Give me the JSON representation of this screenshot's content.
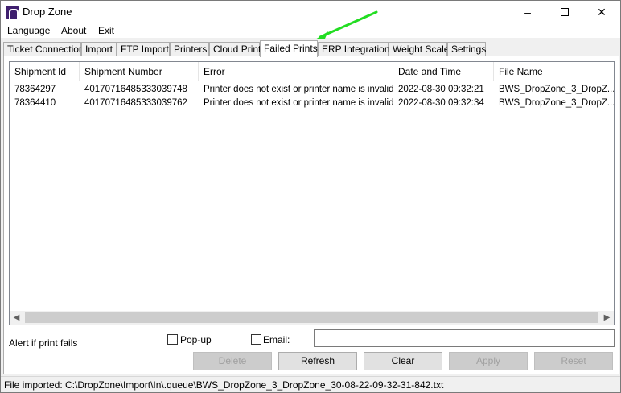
{
  "window": {
    "title": "Drop Zone",
    "icon": "app-logo-icon"
  },
  "controls": {
    "minimize": "–",
    "maximize": "",
    "close": "✕"
  },
  "menu": [
    "Language",
    "About",
    "Exit"
  ],
  "tabs": [
    "Ticket Connection",
    "Import",
    "FTP Import",
    "Printers",
    "Cloud Print",
    "Failed Prints",
    "ERP Integration",
    "Weight Scale",
    "Settings"
  ],
  "active_tab": "Failed Prints",
  "table": {
    "columns": [
      "Shipment Id",
      "Shipment Number",
      "Error",
      "Date and Time",
      "File Name"
    ],
    "rows": [
      [
        "78364297",
        "40170716485333039748",
        "Printer does not exist or printer name is invalid.",
        "2022-08-30 09:32:21",
        "BWS_DropZone_3_DropZ..."
      ],
      [
        "78364410",
        "40170716485333039762",
        "Printer does not exist or printer name is invalid.",
        "2022-08-30 09:32:34",
        "BWS_DropZone_3_DropZ..."
      ]
    ]
  },
  "alert": {
    "label": "Alert if print fails",
    "popup_label": "Pop-up",
    "popup_checked": false,
    "email_label": "Email:",
    "email_checked": false,
    "email_value": ""
  },
  "buttons": {
    "delete": "Delete",
    "refresh": "Refresh",
    "clear": "Clear",
    "apply": "Apply",
    "reset": "Reset"
  },
  "status": "File imported: C:\\DropZone\\Import\\In\\.queue\\BWS_DropZone_3_DropZone_30-08-22-09-32-31-842.txt",
  "annotation": {
    "arrow_color": "#22dd22",
    "icon": "green-arrow-icon"
  }
}
